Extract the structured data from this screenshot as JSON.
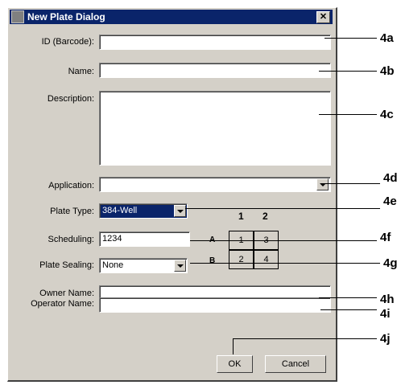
{
  "dialog": {
    "title": "New Plate Dialog",
    "close_glyph": "✕",
    "title_icon": "plate-app-icon"
  },
  "form": {
    "id_label": "ID (Barcode):",
    "id_value": "",
    "name_label": "Name:",
    "name_value": "",
    "description_label": "Description:",
    "description_value": "",
    "application_label": "Application:",
    "application_value": "",
    "plate_type_label": "Plate Type:",
    "plate_type_value": "384-Well",
    "scheduling_label": "Scheduling:",
    "scheduling_value": "1234",
    "plate_sealing_label": "Plate Sealing:",
    "plate_sealing_value": "None",
    "owner_label": "Owner Name:",
    "owner_value": "",
    "operator_label": "Operator Name:",
    "operator_value": ""
  },
  "plate_grid": {
    "columns": [
      "1",
      "2"
    ],
    "rows": [
      "A",
      "B"
    ],
    "cells": [
      "1",
      "3",
      "2",
      "4"
    ]
  },
  "buttons": {
    "ok": "OK",
    "cancel": "Cancel"
  },
  "callouts": [
    "4a",
    "4b",
    "4c",
    "4d",
    "4e",
    "4f",
    "4g",
    "4h",
    "4i",
    "4j"
  ],
  "colors": {
    "dialog_face": "#d4d0c8",
    "titlebar": "#0a246a",
    "selection": "#0a246a"
  }
}
